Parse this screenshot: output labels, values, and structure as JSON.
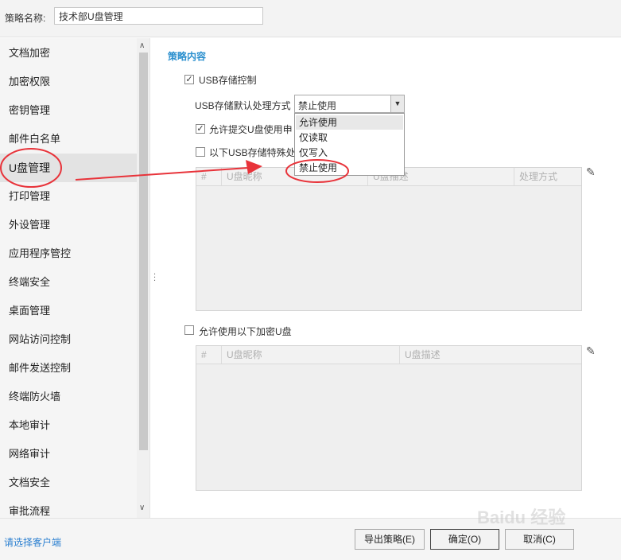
{
  "header": {
    "policy_name_label": "策略名称:",
    "policy_name_value": "技术部U盘管理"
  },
  "sidebar": {
    "items": [
      {
        "label": "文档加密"
      },
      {
        "label": "加密权限"
      },
      {
        "label": "密钥管理"
      },
      {
        "label": "邮件白名单"
      },
      {
        "label": "U盘管理",
        "active": true
      },
      {
        "label": "打印管理"
      },
      {
        "label": "外设管理"
      },
      {
        "label": "应用程序管控"
      },
      {
        "label": "终端安全"
      },
      {
        "label": "桌面管理"
      },
      {
        "label": "网站访问控制"
      },
      {
        "label": "邮件发送控制"
      },
      {
        "label": "终端防火墙"
      },
      {
        "label": "本地审计"
      },
      {
        "label": "网络审计"
      },
      {
        "label": "文档安全"
      },
      {
        "label": "审批流程"
      }
    ]
  },
  "main": {
    "section_title": "策略内容",
    "usb_control": {
      "label": "USB存储控制",
      "checked": true
    },
    "default_mode": {
      "label": "USB存储默认处理方式",
      "selected": "禁止使用",
      "options": [
        "允许使用",
        "仅读取",
        "仅写入",
        "禁止使用"
      ]
    },
    "allow_apply": {
      "label": "允许提交U盘使用申",
      "checked": true
    },
    "special_usb": {
      "label": "以下USB存储特殊处",
      "checked": false
    },
    "table1": {
      "headers": [
        "#",
        "U盘昵称",
        "U盘描述",
        "处理方式"
      ]
    },
    "allow_encrypted": {
      "label": "允许使用以下加密U盘",
      "checked": false
    },
    "table2": {
      "headers": [
        "#",
        "U盘昵称",
        "U盘描述"
      ]
    }
  },
  "footer": {
    "select_client": "请选择客户端",
    "export_button": "导出策略(E)",
    "ok_button": "确定(O)",
    "cancel_button": "取消(C)"
  },
  "watermark": "Baidu 经验",
  "colors": {
    "accent": "#2a8fce",
    "annotation": "#e8333a",
    "link": "#2a7fd0"
  },
  "icons": {
    "checkbox": "check-mark",
    "dropdown": "triangle-down",
    "edit": "pencil-icon",
    "scroll_up": "chevron-up-icon",
    "scroll_down": "chevron-down-icon"
  }
}
